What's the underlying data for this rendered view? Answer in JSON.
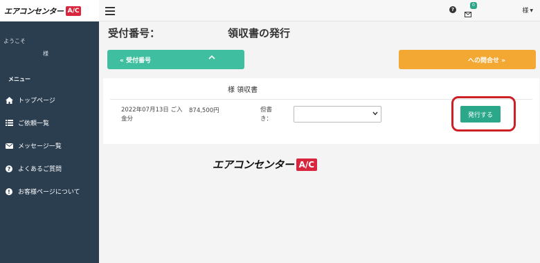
{
  "brand": {
    "name": "エアコンセンター",
    "badge": "A/C"
  },
  "sidebar": {
    "welcome": "ようこそ",
    "user_name": "様",
    "menu_heading": "メニュー",
    "items": [
      {
        "label": "トップページ",
        "icon": "home-icon"
      },
      {
        "label": "ご依頼一覧",
        "icon": "list-icon"
      },
      {
        "label": "メッセージ一覧",
        "icon": "envelope-icon"
      },
      {
        "label": "よくあるご質問",
        "icon": "question-circle-icon"
      },
      {
        "label": "お客様ページについて",
        "icon": "info-circle-icon"
      }
    ]
  },
  "topbar": {
    "mail_count": "0",
    "user_label": "様"
  },
  "main": {
    "title_left": "受付番号：",
    "title_right": "領収書の発行",
    "receipt_button": "« 受付番号",
    "inquiry_button": "への問合せ »",
    "panel_title": "様 領収書",
    "row": {
      "description": "2022年07月13日 ご入金分",
      "amount": "874,500円",
      "note_label": "但書き：",
      "issue_button": "発行する"
    }
  },
  "colors": {
    "sidebar_bg": "#2b3e50",
    "green": "#3fbf9f",
    "orange": "#f4a834",
    "issue_green": "#2aa889",
    "highlight_red": "#cc1f26"
  }
}
